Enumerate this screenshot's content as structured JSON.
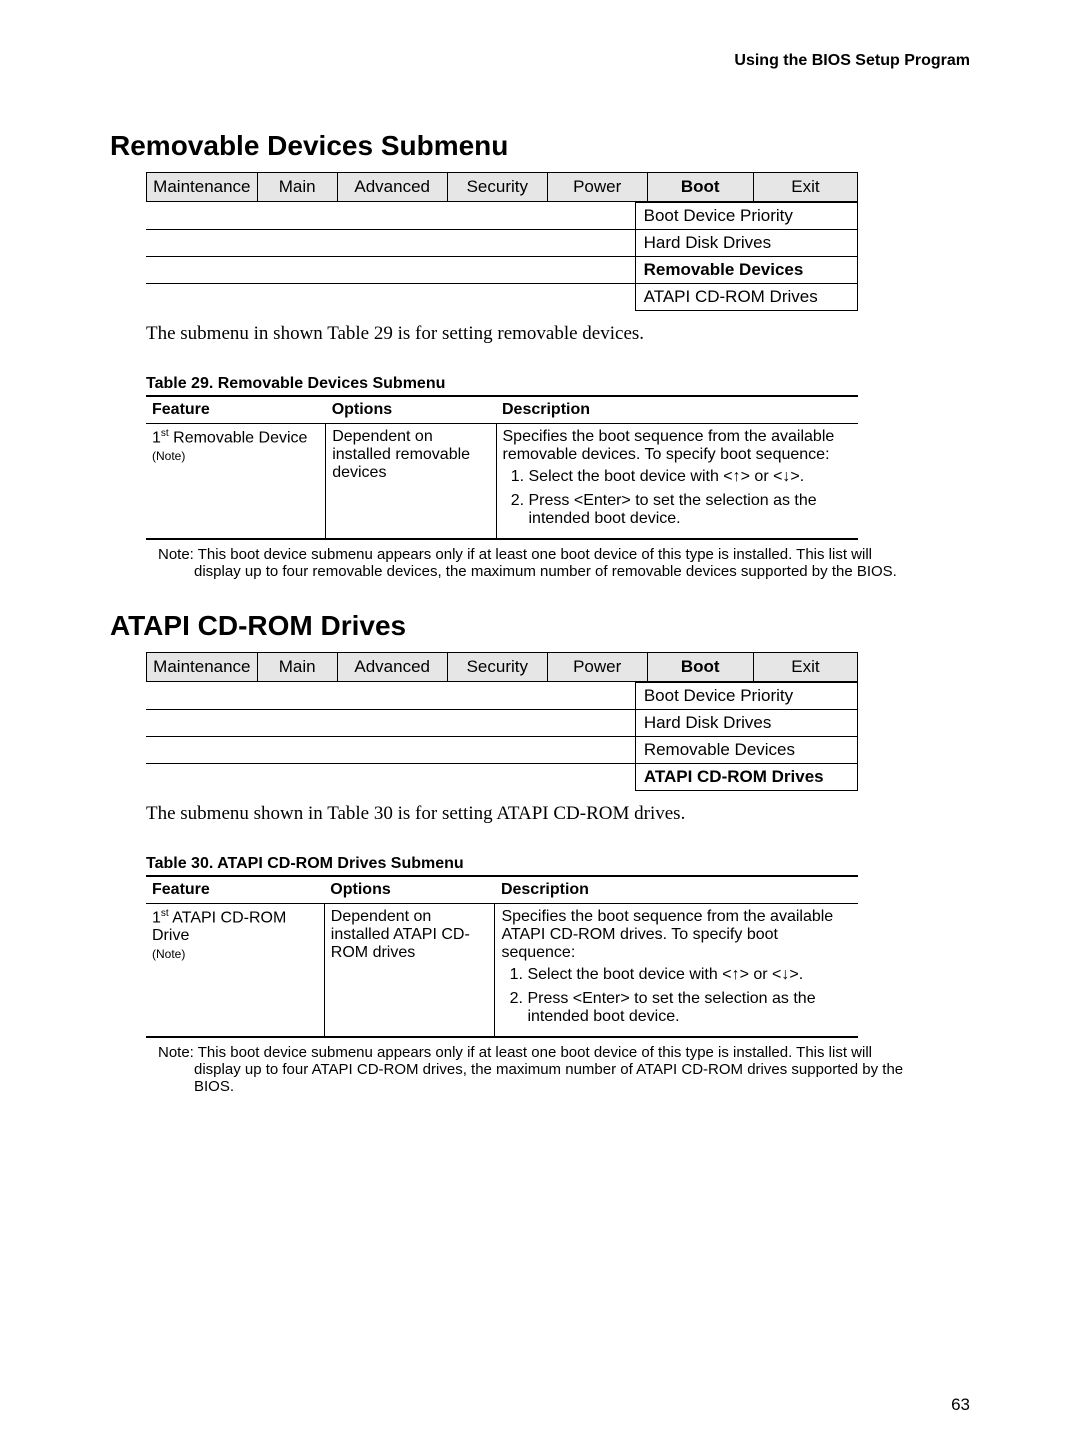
{
  "header": "Using the BIOS Setup Program",
  "section1": {
    "title": "Removable Devices Submenu",
    "nav": [
      "Maintenance",
      "Main",
      "Advanced",
      "Security",
      "Power",
      "Boot",
      "Exit"
    ],
    "nav_active": "Boot",
    "subnav": [
      "Boot Device Priority",
      "Hard Disk Drives",
      "Removable Devices",
      "ATAPI CD-ROM Drives"
    ],
    "subnav_active": "Removable Devices",
    "intro": "The submenu in shown Table 29 is for setting removable devices.",
    "table_caption": "Table 29.    Removable Devices Submenu",
    "th": [
      "Feature",
      "Options",
      "Description"
    ],
    "row": {
      "feature_main": "1",
      "feature_sup": "st",
      "feature_rest": " Removable Device",
      "feature_note": "(Note)",
      "options": "Dependent on installed removable devices",
      "desc_intro": "Specifies the boot sequence from the available removable devices.  To specify boot sequence:",
      "desc_item1": "Select the boot device with <↑> or <↓>.",
      "desc_item2": "Press <Enter> to set the selection as the intended boot device."
    },
    "note": "Note:  This boot device submenu appears only if at least one boot device of this type is installed.  This list will display up to four removable devices, the maximum number of removable devices supported by the BIOS."
  },
  "section2": {
    "title": "ATAPI CD-ROM Drives",
    "nav": [
      "Maintenance",
      "Main",
      "Advanced",
      "Security",
      "Power",
      "Boot",
      "Exit"
    ],
    "nav_active": "Boot",
    "subnav": [
      "Boot Device Priority",
      "Hard Disk Drives",
      "Removable Devices",
      "ATAPI CD-ROM Drives"
    ],
    "subnav_active": "ATAPI CD-ROM Drives",
    "intro": "The submenu shown in Table 30 is for setting ATAPI CD-ROM drives.",
    "table_caption": "Table 30.    ATAPI CD-ROM Drives Submenu",
    "th": [
      "Feature",
      "Options",
      "Description"
    ],
    "row": {
      "feature_main": "1",
      "feature_sup": "st",
      "feature_rest": " ATAPI CD-ROM Drive",
      "feature_note": "(Note)",
      "options": "Dependent on installed ATAPI CD-ROM drives",
      "desc_intro": "Specifies the boot sequence from the available ATAPI CD-ROM drives.  To specify boot sequence:",
      "desc_item1": "Select the boot device with <↑> or <↓>.",
      "desc_item2": "Press <Enter> to set the selection as the intended boot device."
    },
    "note": "Note:  This boot device submenu appears only if at least one boot device of this type is installed.  This list will display up to four ATAPI CD-ROM drives, the maximum number of ATAPI CD-ROM drives supported by the BIOS."
  },
  "page_number": "63"
}
